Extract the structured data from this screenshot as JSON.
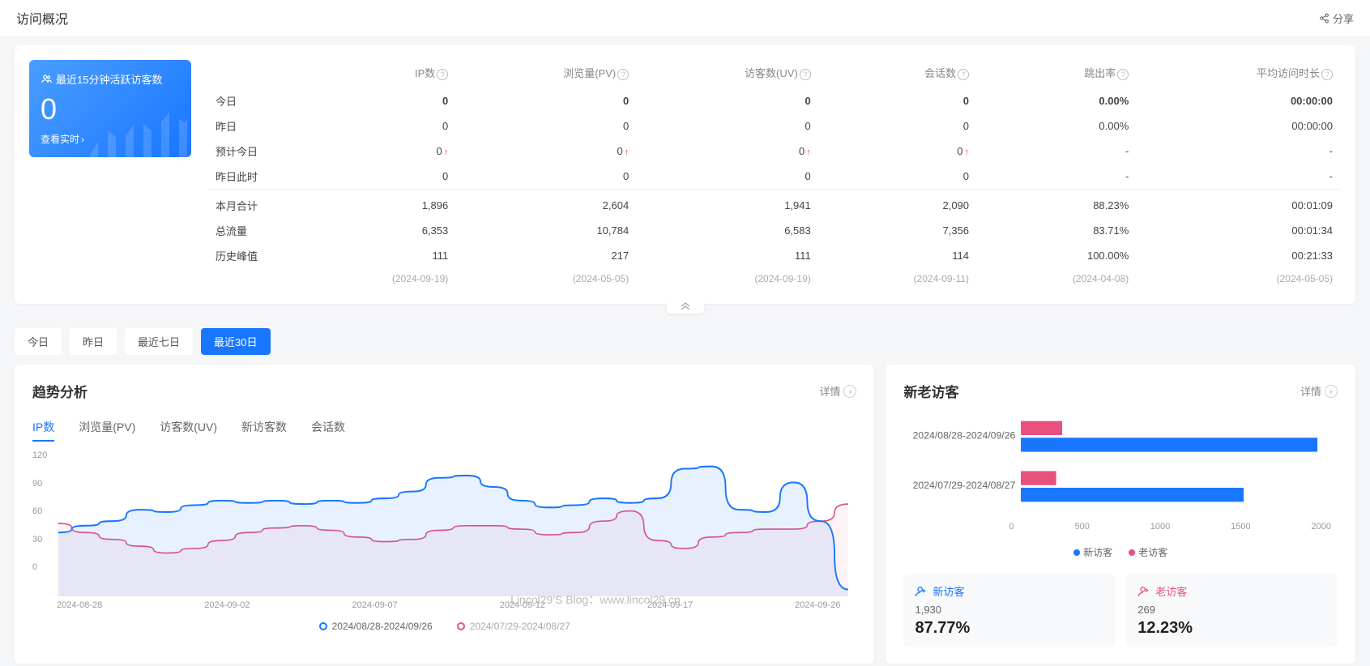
{
  "header": {
    "title": "访问概况",
    "share": "分享"
  },
  "active": {
    "label": "最近15分钟活跃访客数",
    "value": "0",
    "link": "查看实时"
  },
  "columns": [
    "IP数",
    "浏览量(PV)",
    "访客数(UV)",
    "会话数",
    "跳出率",
    "平均访问时长"
  ],
  "rowLabels": {
    "today": "今日",
    "yesterday": "昨日",
    "predict": "预计今日",
    "sameTime": "昨日此时",
    "monthTotal": "本月合计",
    "total": "总流量",
    "peak": "历史峰值"
  },
  "overview": {
    "today": {
      "ip": "0",
      "pv": "0",
      "uv": "0",
      "sessions": "0",
      "bounce": "0.00%",
      "duration": "00:00:00"
    },
    "yesterday": {
      "ip": "0",
      "pv": "0",
      "uv": "0",
      "sessions": "0",
      "bounce": "0.00%",
      "duration": "00:00:00"
    },
    "predict": {
      "ip": "0",
      "pv": "0",
      "uv": "0",
      "sessions": "0",
      "bounce": "-",
      "duration": "-"
    },
    "sameTime": {
      "ip": "0",
      "pv": "0",
      "uv": "0",
      "sessions": "0",
      "bounce": "-",
      "duration": "-"
    },
    "monthTotal": {
      "ip": "1,896",
      "pv": "2,604",
      "uv": "1,941",
      "sessions": "2,090",
      "bounce": "88.23%",
      "duration": "00:01:09"
    },
    "total": {
      "ip": "6,353",
      "pv": "10,784",
      "uv": "6,583",
      "sessions": "7,356",
      "bounce": "83.71%",
      "duration": "00:01:34"
    },
    "peak": {
      "ip": "111",
      "pv": "217",
      "uv": "111",
      "sessions": "114",
      "bounce": "100.00%",
      "duration": "00:21:33"
    },
    "peakDates": {
      "ip": "(2024-09-19)",
      "pv": "(2024-05-05)",
      "uv": "(2024-09-19)",
      "sessions": "(2024-09-11)",
      "bounce": "(2024-04-08)",
      "duration": "(2024-05-05)"
    }
  },
  "rangeTabs": {
    "today": "今日",
    "yesterday": "昨日",
    "last7": "最近七日",
    "last30": "最近30日"
  },
  "trend": {
    "title": "趋势分析",
    "detail": "详情",
    "subtabs": {
      "ip": "IP数",
      "pv": "浏览量(PV)",
      "uv": "访客数(UV)",
      "new": "新访客数",
      "sessions": "会话数"
    },
    "legend1": "2024/08/28-2024/09/26",
    "legend2": "2024/07/29-2024/08/27",
    "xlabels": {
      "x0": "2024-08-28",
      "x1": "2024-09-02",
      "x2": "2024-09-07",
      "x3": "2024-09-12",
      "x4": "2024-09-17",
      "x5": "2024-09-26"
    },
    "yticks": {
      "y0": "0",
      "y1": "30",
      "y2": "60",
      "y3": "90",
      "y4": "120"
    }
  },
  "visitors": {
    "title": "新老访客",
    "detail": "详情",
    "range1": "2024/08/28-2024/09/26",
    "range2": "2024/07/29-2024/08/27",
    "xticks": {
      "x0": "0",
      "x1": "500",
      "x2": "1000",
      "x3": "1500",
      "x4": "2000"
    },
    "legendNew": "新访客",
    "legendOld": "老访客",
    "newLabel": "新访客",
    "newCount": "1,930",
    "newPct": "87.77%",
    "oldLabel": "老访客",
    "oldCount": "269",
    "oldPct": "12.23%"
  },
  "watermark": "Lincol29'S Blog：www.lincol29.cn",
  "chart_data": [
    {
      "type": "line",
      "title": "趋势分析 - IP数",
      "xlabel": "",
      "ylabel": "",
      "ylim": [
        0,
        120
      ],
      "x": [
        "2024-08-28",
        "2024-08-29",
        "2024-08-30",
        "2024-08-31",
        "2024-09-01",
        "2024-09-02",
        "2024-09-03",
        "2024-09-04",
        "2024-09-05",
        "2024-09-06",
        "2024-09-07",
        "2024-09-08",
        "2024-09-09",
        "2024-09-10",
        "2024-09-11",
        "2024-09-12",
        "2024-09-13",
        "2024-09-14",
        "2024-09-15",
        "2024-09-16",
        "2024-09-17",
        "2024-09-18",
        "2024-09-19",
        "2024-09-20",
        "2024-09-21",
        "2024-09-22",
        "2024-09-23",
        "2024-09-24",
        "2024-09-25",
        "2024-09-26"
      ],
      "series": [
        {
          "name": "2024/08/28-2024/09/26",
          "values": [
            52,
            58,
            62,
            72,
            70,
            76,
            80,
            78,
            80,
            77,
            80,
            78,
            82,
            88,
            100,
            102,
            92,
            80,
            74,
            76,
            82,
            78,
            82,
            108,
            110,
            72,
            70,
            96,
            62,
            2
          ]
        },
        {
          "name": "2024/07/29-2024/08/27",
          "values": [
            60,
            52,
            46,
            40,
            34,
            38,
            45,
            52,
            56,
            58,
            54,
            48,
            44,
            46,
            54,
            58,
            58,
            55,
            50,
            52,
            62,
            71,
            45,
            38,
            48,
            52,
            55,
            55,
            62,
            77
          ]
        }
      ]
    },
    {
      "type": "bar",
      "title": "新老访客",
      "orientation": "horizontal",
      "xlim": [
        0,
        2000
      ],
      "categories": [
        "2024/08/28-2024/09/26",
        "2024/07/29-2024/08/27"
      ],
      "series": [
        {
          "name": "新访客",
          "values": [
            1930,
            1450
          ]
        },
        {
          "name": "老访客",
          "values": [
            269,
            230
          ]
        }
      ]
    }
  ]
}
